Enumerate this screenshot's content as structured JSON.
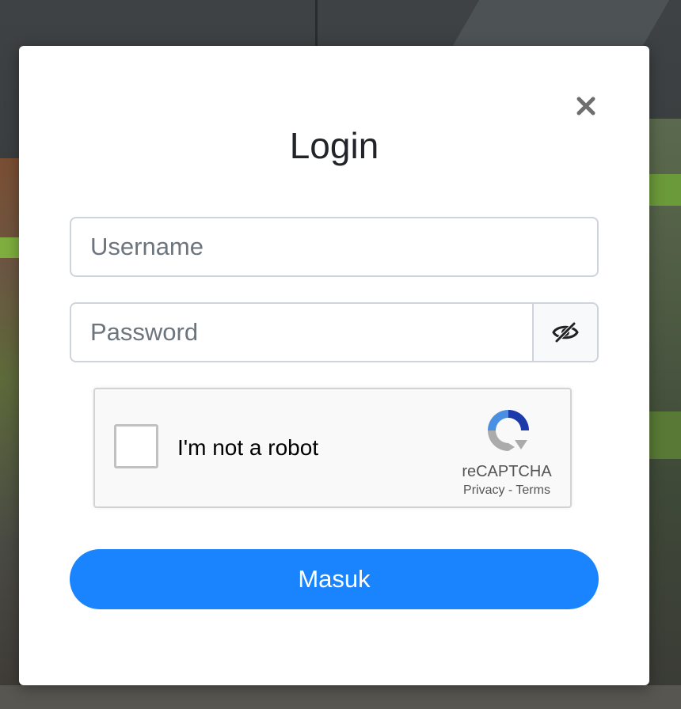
{
  "colors": {
    "primary": "#1a84ff",
    "input_border": "#ced4da",
    "title_text": "#212529",
    "placeholder": "#6c757d",
    "captcha_bg": "#f9f9f9"
  },
  "modal": {
    "close_icon": "close-icon",
    "title": "Login"
  },
  "form": {
    "username_placeholder": "Username",
    "password_placeholder": "Password",
    "password_toggle_icon": "eye-slash-icon",
    "submit_label": "Masuk"
  },
  "captcha": {
    "label": "I'm not a robot",
    "brand": "reCAPTCHA",
    "privacy": "Privacy",
    "separator": "-",
    "terms": "Terms",
    "logo_icon": "recaptcha-logo-icon"
  }
}
